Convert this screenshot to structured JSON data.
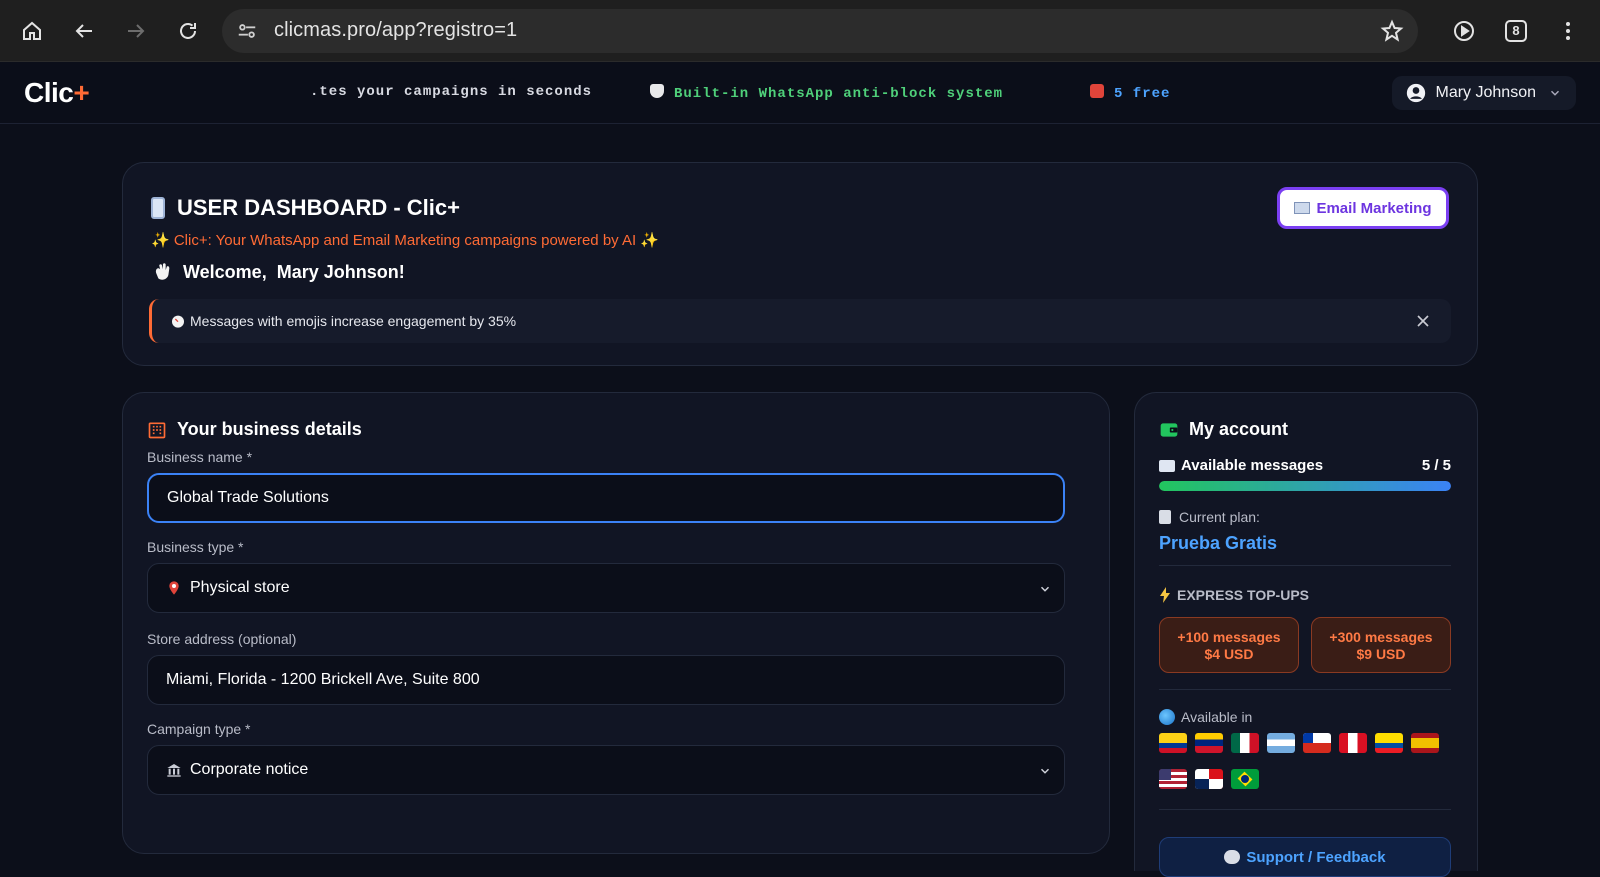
{
  "browser": {
    "url": "clicmas.pro/app?registro=1",
    "tab_count": "8"
  },
  "header": {
    "logo_main": "Clic",
    "logo_plus": "+",
    "ticker": [
      ".tes your campaigns in seconds",
      "Built-in WhatsApp anti-block system",
      "5 free"
    ],
    "user_name": "Mary Johnson"
  },
  "dashboard": {
    "title": "USER DASHBOARD - Clic+",
    "tagline": "✨ Clic+: Your WhatsApp and Email Marketing campaigns powered by AI ✨",
    "welcome_prefix": "Welcome,",
    "welcome_name": "Mary Johnson!",
    "tip": "Messages with emojis increase engagement by 35%",
    "email_button": "Email Marketing"
  },
  "business": {
    "title": "Your business details",
    "name_label": "Business name *",
    "name_value": "Global Trade Solutions",
    "type_label": "Business type *",
    "type_value": "Physical store",
    "address_label": "Store address (optional)",
    "address_value": "Miami, Florida - 1200 Brickell Ave, Suite 800",
    "campaign_label": "Campaign type *",
    "campaign_value": "Corporate notice"
  },
  "account": {
    "title": "My account",
    "available_label": "Available messages",
    "available_value": "5 / 5",
    "available_fraction": 1.0,
    "plan_label": "Current plan:",
    "plan_name": "Prueba Gratis",
    "express_label": "EXPRESS TOP-UPS",
    "topups": [
      {
        "line1": "+100 messages",
        "line2": "$4 USD"
      },
      {
        "line1": "+300 messages",
        "line2": "$9 USD"
      }
    ],
    "available_in_label": "Available in",
    "flags": [
      "colombia-flag",
      "venezuela-flag",
      "mexico-flag",
      "argentina-flag",
      "chile-flag",
      "peru-flag",
      "ecuador-flag",
      "spain-flag",
      "usa-flag",
      "panama-flag",
      "brazil-flag"
    ],
    "support_label": "Support / Feedback"
  },
  "colors": {
    "accent_orange": "#ff6b35",
    "accent_blue": "#4da3ff",
    "accent_purple": "#7b3ff2",
    "success_green": "#22c55e"
  }
}
